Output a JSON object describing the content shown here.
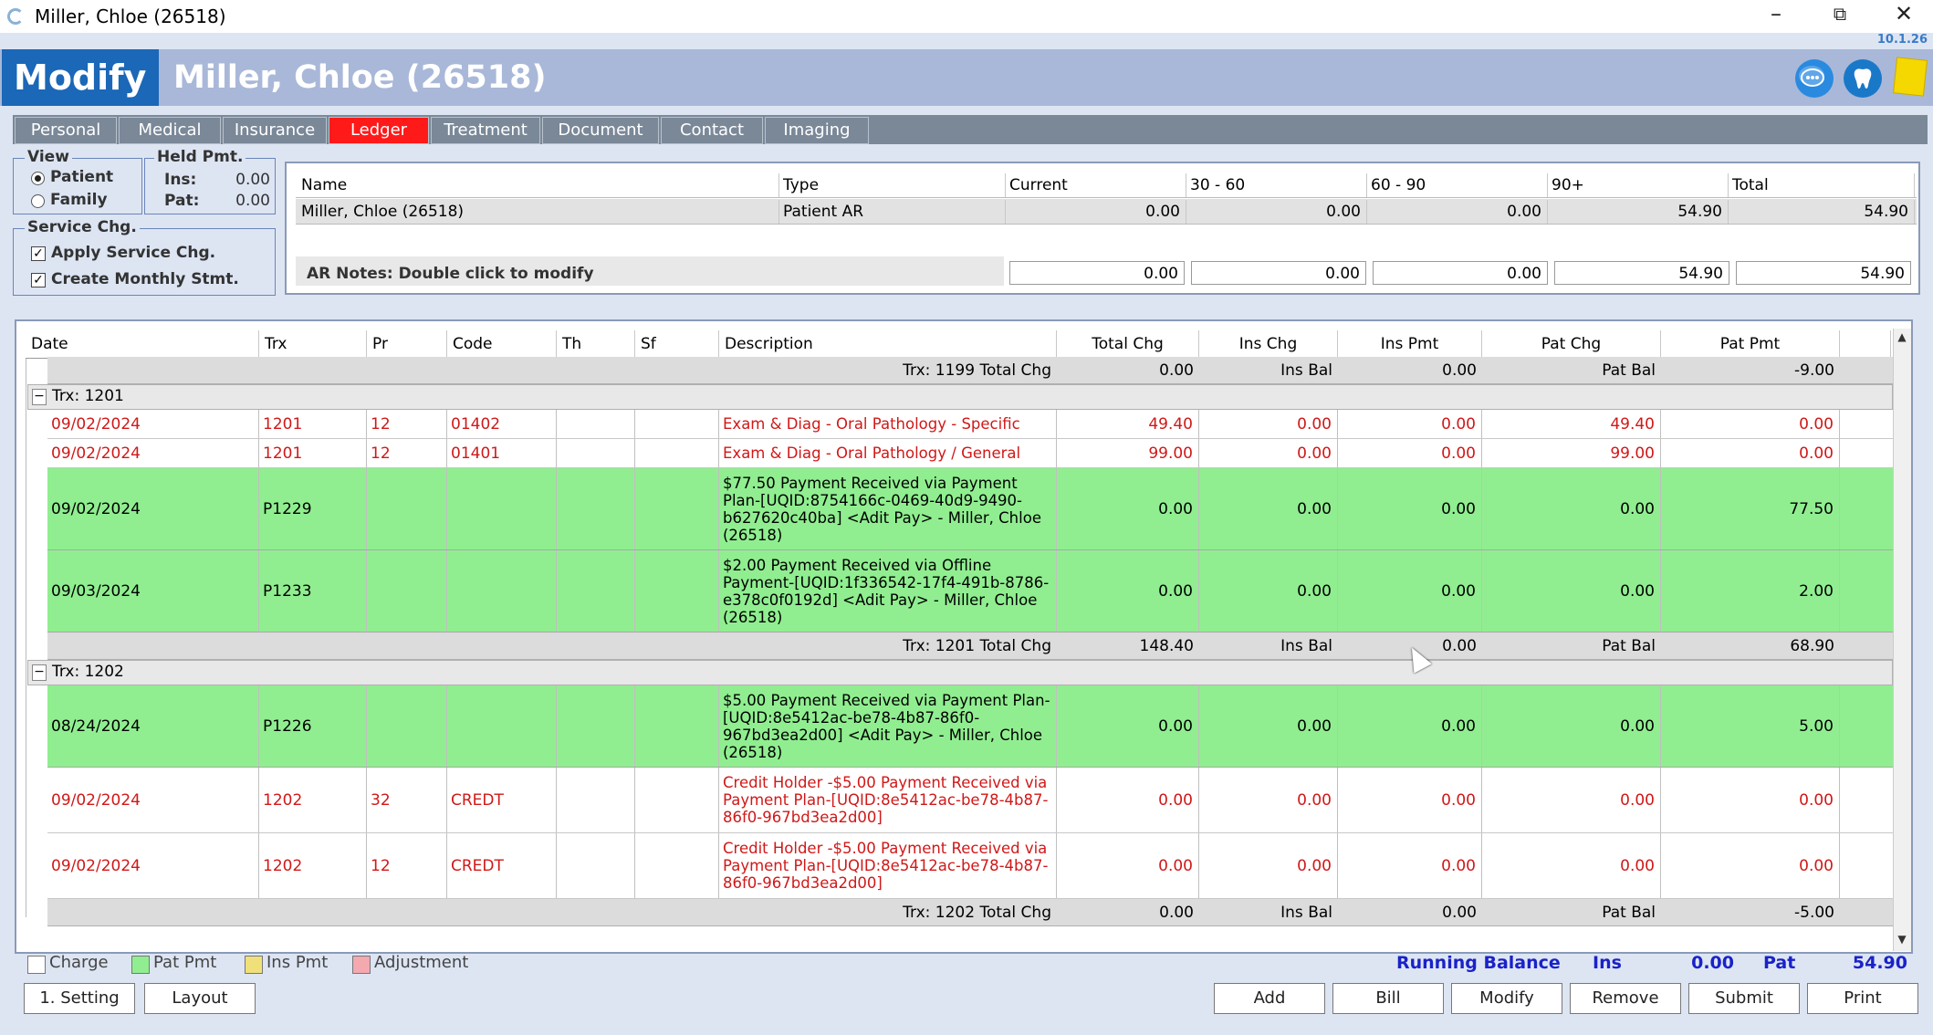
{
  "window": {
    "title": "Miller, Chloe (26518)",
    "version": "10.1.26"
  },
  "header": {
    "mode": "Modify",
    "patient": "Miller, Chloe (26518)"
  },
  "header_icons": [
    "chat-icon",
    "tooth-icon",
    "sticky-note-icon"
  ],
  "tabs": [
    "Personal",
    "Medical",
    "Insurance",
    "Ledger",
    "Treatment",
    "Document",
    "Contact",
    "Imaging"
  ],
  "active_tab": "Ledger",
  "view": {
    "title": "View",
    "patient": "Patient",
    "family": "Family",
    "selected": "Patient"
  },
  "held_pmt": {
    "title": "Held Pmt.",
    "ins_label": "Ins:",
    "ins": "0.00",
    "pat_label": "Pat:",
    "pat": "0.00"
  },
  "service_chg": {
    "title": "Service Chg.",
    "apply": "Apply Service Chg.",
    "monthly": "Create Monthly Stmt."
  },
  "ar": {
    "headers": [
      "Name",
      "Type",
      "Current",
      "30 - 60",
      "60 - 90",
      "90+",
      "Total"
    ],
    "row": [
      "Miller, Chloe (26518)",
      "Patient AR",
      "0.00",
      "0.00",
      "0.00",
      "54.90",
      "54.90"
    ],
    "notes": "AR Notes: Double click to modify",
    "totals": [
      "0.00",
      "0.00",
      "0.00",
      "54.90",
      "54.90"
    ]
  },
  "ledger": {
    "headers": [
      "Date",
      "Trx",
      "Pr",
      "Code",
      "Th",
      "Sf",
      "Description",
      "Total Chg",
      "Ins Chg",
      "Ins Pmt",
      "Pat Chg",
      "Pat Pmt"
    ],
    "top_total": {
      "label": "Trx: 1199 Total Chg",
      "total_chg": "0.00",
      "ins_bal_label": "Ins Bal",
      "ins_bal": "0.00",
      "pat_bal_label": "Pat Bal",
      "pat_bal": "-9.00"
    },
    "groups": [
      {
        "label": "Trx: 1201",
        "toggle": "−",
        "rows": [
          {
            "kind": "charge",
            "date": "09/02/2024",
            "trx": "1201",
            "pr": "12",
            "code": "01402",
            "th": "",
            "sf": "",
            "desc": "Exam & Diag - Oral Pathology - Specific",
            "total_chg": "49.40",
            "ins_chg": "0.00",
            "ins_pmt": "0.00",
            "pat_chg": "49.40",
            "pat_pmt": "0.00"
          },
          {
            "kind": "charge",
            "date": "09/02/2024",
            "trx": "1201",
            "pr": "12",
            "code": "01401",
            "th": "",
            "sf": "",
            "desc": "Exam & Diag - Oral Pathology / General",
            "total_chg": "99.00",
            "ins_chg": "0.00",
            "ins_pmt": "0.00",
            "pat_chg": "99.00",
            "pat_pmt": "0.00"
          },
          {
            "kind": "patpmt",
            "date": "09/02/2024",
            "trx": "P1229",
            "pr": "",
            "code": "",
            "th": "",
            "sf": "",
            "desc": "$77.50 Payment Received via Payment Plan-[UQID:8754166c-0469-40d9-9490-b627620c40ba] <Adit Pay>  - Miller, Chloe (26518)",
            "total_chg": "0.00",
            "ins_chg": "0.00",
            "ins_pmt": "0.00",
            "pat_chg": "0.00",
            "pat_pmt": "77.50"
          },
          {
            "kind": "patpmt",
            "date": "09/03/2024",
            "trx": "P1233",
            "pr": "",
            "code": "",
            "th": "",
            "sf": "",
            "desc": "$2.00 Payment Received via Offline Payment-[UQID:1f336542-17f4-491b-8786-e378c0f0192d] <Adit Pay>  -  Miller, Chloe (26518)",
            "total_chg": "0.00",
            "ins_chg": "0.00",
            "ins_pmt": "0.00",
            "pat_chg": "0.00",
            "pat_pmt": "2.00"
          }
        ],
        "total": {
          "label": "Trx: 1201 Total Chg",
          "total_chg": "148.40",
          "ins_bal_label": "Ins Bal",
          "ins_bal": "0.00",
          "pat_bal_label": "Pat Bal",
          "pat_bal": "68.90"
        }
      },
      {
        "label": "Trx: 1202",
        "toggle": "−",
        "rows": [
          {
            "kind": "patpmt",
            "date": "08/24/2024",
            "trx": "P1226",
            "pr": "",
            "code": "",
            "th": "",
            "sf": "",
            "desc": "$5.00 Payment Received via Payment Plan-[UQID:8e5412ac-be78-4b87-86f0-967bd3ea2d00] <Adit Pay>  - Miller, Chloe (26518)",
            "total_chg": "0.00",
            "ins_chg": "0.00",
            "ins_pmt": "0.00",
            "pat_chg": "0.00",
            "pat_pmt": "5.00"
          },
          {
            "kind": "charge",
            "date": "09/02/2024",
            "trx": "1202",
            "pr": "32",
            "code": "CREDT",
            "th": "",
            "sf": "",
            "desc": "Credit Holder -$5.00 Payment Received via Payment Plan-[UQID:8e5412ac-be78-4b87-86f0-967bd3ea2d00]",
            "total_chg": "0.00",
            "ins_chg": "0.00",
            "ins_pmt": "0.00",
            "pat_chg": "0.00",
            "pat_pmt": "0.00"
          },
          {
            "kind": "charge",
            "date": "09/02/2024",
            "trx": "1202",
            "pr": "12",
            "code": "CREDT",
            "th": "",
            "sf": "",
            "desc": "Credit Holder -$5.00 Payment Received via Payment Plan-[UQID:8e5412ac-be78-4b87-86f0-967bd3ea2d00]",
            "total_chg": "0.00",
            "ins_chg": "0.00",
            "ins_pmt": "0.00",
            "pat_chg": "0.00",
            "pat_pmt": "0.00"
          }
        ],
        "total": {
          "label": "Trx: 1202 Total Chg",
          "total_chg": "0.00",
          "ins_bal_label": "Ins Bal",
          "ins_bal": "0.00",
          "pat_bal_label": "Pat Bal",
          "pat_bal": "-5.00"
        }
      }
    ]
  },
  "legend": [
    {
      "label": "Charge",
      "color": "#ffffff"
    },
    {
      "label": "Pat Pmt",
      "color": "#90ee90"
    },
    {
      "label": "Ins Pmt",
      "color": "#f0e07a"
    },
    {
      "label": "Adjustment",
      "color": "#f4a8b0"
    }
  ],
  "running_balance": {
    "label": "Running Balance",
    "ins_label": "Ins",
    "ins": "0.00",
    "pat_label": "Pat",
    "pat": "54.90"
  },
  "buttons_left": [
    "1. Setting",
    "Layout"
  ],
  "buttons_right": [
    "Add",
    "Bill",
    "Modify",
    "Remove",
    "Submit",
    "Print"
  ],
  "colors": {
    "accent": "#1b67b8",
    "header_bar": "#a9b8d8",
    "active_tab": "#ff1a1a",
    "tab_bar": "#7a8898",
    "charge_text": "#d01818",
    "running_balance": "#1a22c8"
  }
}
